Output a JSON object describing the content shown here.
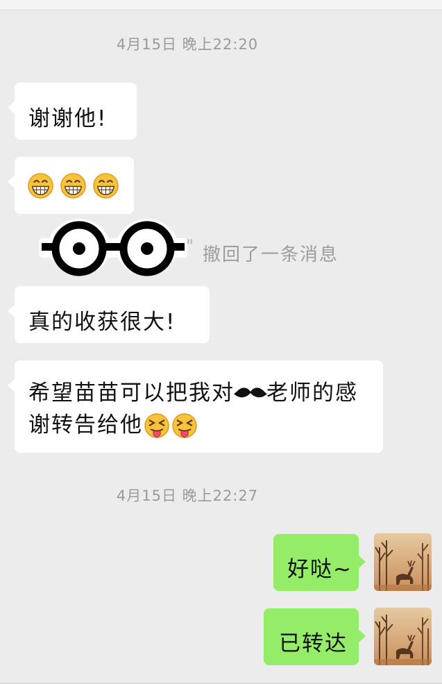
{
  "timestamps": [
    "4月15日 晚上22:20",
    "4月15日 晚上22:27"
  ],
  "messages": {
    "m1": "谢谢他!",
    "m3": "真的收获很大!",
    "m4_part1": "希望苗苗可以把我对",
    "m4_part2": "老师的感谢转告给他",
    "m5": "好哒~",
    "m6": "已转达"
  },
  "recall": {
    "quote_open": "\"",
    "quote_close": "\"",
    "text": "撤回了一条消息"
  },
  "icons": {
    "grin": "grinning-face-icon",
    "tongue": "squinting-tongue-face-icon",
    "glasses": "glasses-sticker",
    "mustache": "mustache-sticker",
    "avatar": "deer-avatar"
  },
  "colors": {
    "background": "#ececec",
    "incoming_bubble": "#ffffff",
    "outgoing_bubble": "#95ec69",
    "timestamp_text": "#9a9a9a"
  }
}
